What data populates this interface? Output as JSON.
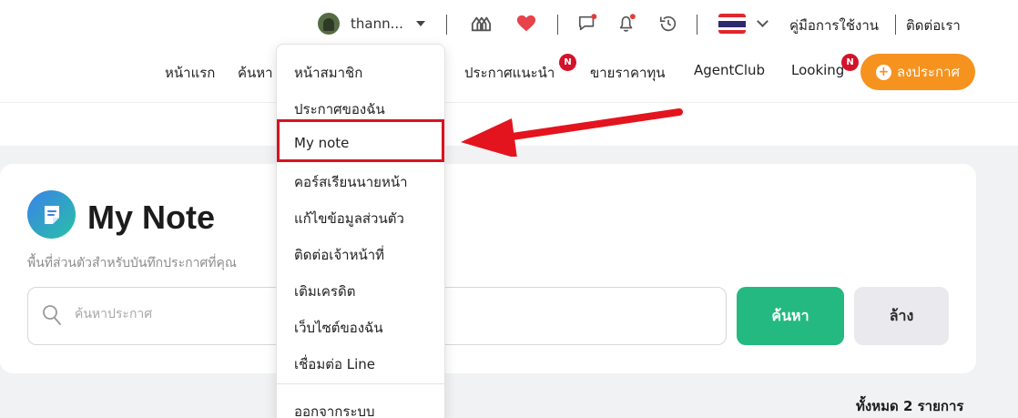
{
  "user": {
    "name": "thann..."
  },
  "top_links": {
    "manual": "คู่มือการใช้งาน",
    "contact": "ติดต่อเรา"
  },
  "nav": {
    "items": [
      {
        "label": "หน้าแรก"
      },
      {
        "label": "ค้นหา"
      },
      {
        "label": "ประกาศแนะนำ",
        "badge": "N"
      },
      {
        "label": "ขายราคาทุน"
      },
      {
        "label": "AgentClub"
      },
      {
        "label": "Looking",
        "badge": "N"
      }
    ],
    "post_button": "ลงประกาศ"
  },
  "dropdown": {
    "items": [
      "หน้าสมาชิก",
      "ประกาศของฉัน",
      "My note",
      "คอร์สเรียนนายหน้า",
      "แก้ไขข้อมูลส่วนตัว",
      "ติดต่อเจ้าหน้าที่",
      "เติมเครดิต",
      "เว็บไซต์ของฉัน",
      "เชื่อมต่อ Line",
      "ออกจากระบบ"
    ],
    "highlighted": "My note"
  },
  "page": {
    "title": "My Note",
    "subtitle": "พื้นที่ส่วนตัวสำหรับบันทึกประกาศที่คุณ"
  },
  "search": {
    "placeholder": "ค้นหาประกาศ",
    "value": "",
    "search_button": "ค้นหา",
    "clear_button": "ล้าง"
  },
  "results": {
    "total": "ทั้งหมด 2 รายการ"
  },
  "colors": {
    "accent_orange": "#f6921e",
    "search_green": "#25b982",
    "badge_red": "#d4122a",
    "highlight_red": "#d8131f"
  },
  "icons": {
    "topbar": [
      "compare-icon",
      "heart-icon",
      "chat-icon",
      "bell-icon",
      "history-icon"
    ],
    "flag": "thailand-flag-icon"
  }
}
